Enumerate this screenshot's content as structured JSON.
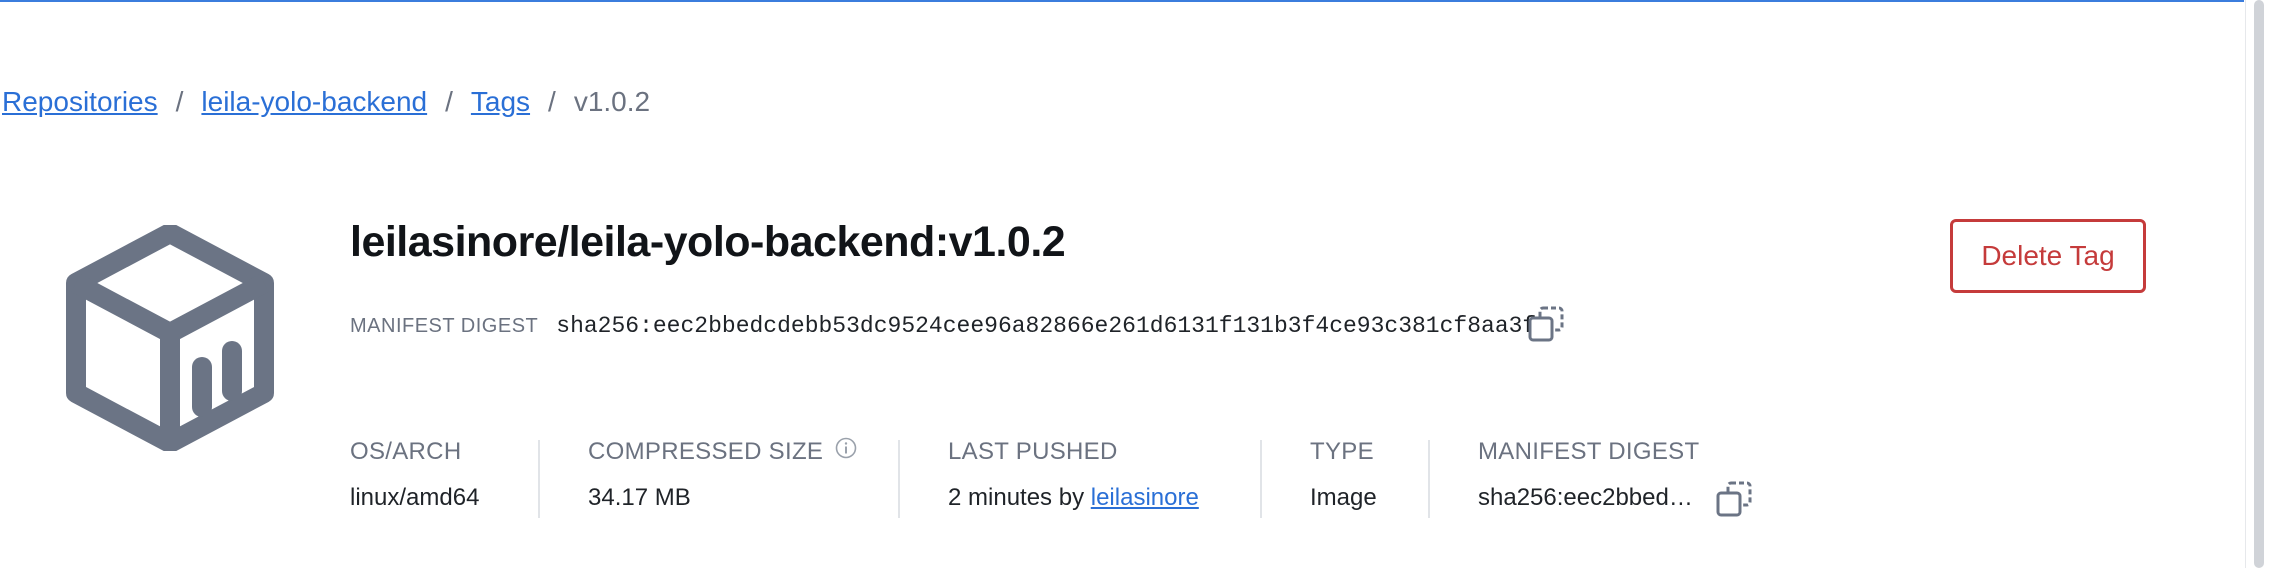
{
  "breadcrumb": {
    "repositories": "Repositories",
    "repo": "leila-yolo-backend",
    "tags": "Tags",
    "current": "v1.0.2",
    "separator": "/"
  },
  "header": {
    "title": "leilasinore/leila-yolo-backend:v1.0.2",
    "digest_label": "MANIFEST DIGEST",
    "digest_value": "sha256:eec2bbedcdebb53dc9524cee96a82866e261d6131f131b3f4ce93c381cf8aa3f",
    "delete_label": "Delete Tag"
  },
  "meta": {
    "os_arch_label": "OS/ARCH",
    "os_arch_value": "linux/amd64",
    "size_label": "COMPRESSED SIZE",
    "size_value": "34.17 MB",
    "pushed_label": "LAST PUSHED",
    "pushed_prefix": "2 minutes by",
    "pushed_user": "leilasinore",
    "type_label": "TYPE",
    "type_value": "Image",
    "digest_label": "MANIFEST DIGEST",
    "digest_value": "sha256:eec2bbed…"
  },
  "colors": {
    "accent": "#2a6fd6",
    "danger": "#c53b3b",
    "icon_gray": "#6b7485"
  },
  "icons": [
    "repository-box-icon",
    "copy-icon",
    "info-icon"
  ]
}
